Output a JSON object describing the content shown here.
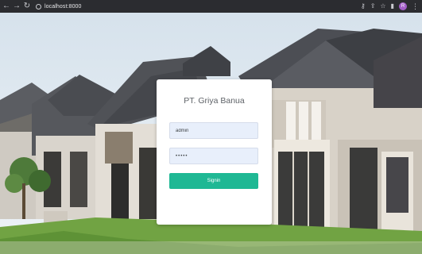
{
  "browser": {
    "back_icon": "arrow-left-icon",
    "forward_icon": "arrow-right-icon",
    "reload_icon": "reload-icon",
    "url": "localhost:8000",
    "avatar_letter": "R"
  },
  "login": {
    "title": "PT. Griya Banua",
    "username_value": "admin",
    "password_value": "•••••",
    "signin_label": "Signin",
    "button_color": "#1fb894"
  }
}
